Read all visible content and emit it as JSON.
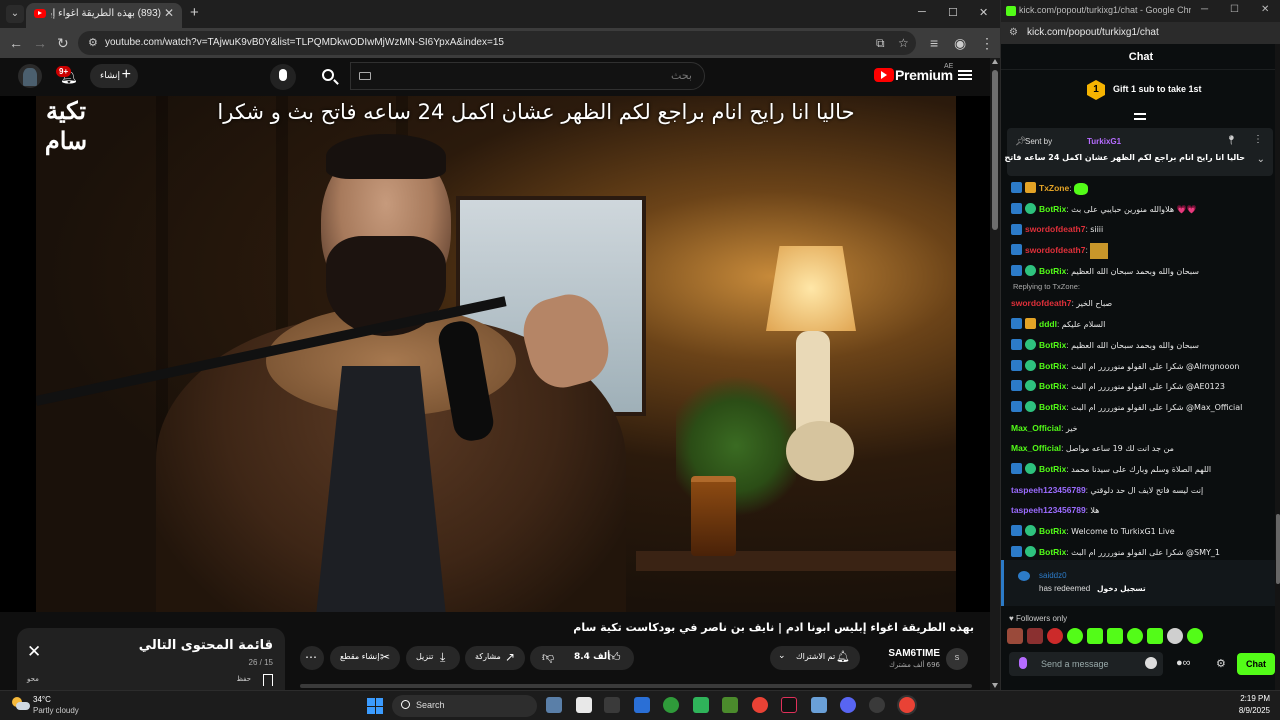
{
  "youtube_window": {
    "tab_title": "(893) بهذه الطريقة اغواء إبليس",
    "url": "youtube.com/watch?v=TAjwuK9vB0Y&list=TLPQMDkwODIwMjWzMN-SI6YpxA&index=15",
    "masthead": {
      "notif_count": "9+",
      "create_label": "إنشاء",
      "search_placeholder": "بحث",
      "logo_text": "Premium",
      "country_code": "AE"
    },
    "video": {
      "channel_logo_line1": "تكية",
      "channel_logo_line2": "سام",
      "on_screen_caption": "حاليا انا رايح انام براجع لكم الظهر عشان اكمل 24 ساعه فاتح بث و شكرا"
    },
    "below": {
      "title": "بهذه الطريقة اغواء إبليس ابونا ادم | نايف بن ناصر في بودكاست تكية سام",
      "channel_name": "SAM6TIME",
      "subscribers": "696 ألف مشترك",
      "subscribed_label": "تم الاشتراك",
      "likes": "8.4 ألف",
      "share_label": "مشاركة",
      "download_label": "تنزيل",
      "clip_label": "إنشاء مقطع"
    },
    "playlist": {
      "title": "قائمة المحتوى التالي",
      "count": "26 / 15",
      "save_label": "حفظ",
      "delete_label": "محو"
    }
  },
  "kick_window": {
    "window_title": "kick.com/popout/turkixg1/chat - Google Chro...",
    "url": "kick.com/popout/turkixg1/chat",
    "header": "Chat",
    "gift_badge": "1",
    "gift_text": "Gift 1 sub to take 1st",
    "pinned": {
      "sent_by_label": "Sent by",
      "sender": "TurkixG1",
      "message": "حاليا انا رايح انام براجع لكم الظهر عشان اكمل 24 ساعه فاتح بث و شكرا"
    },
    "messages": [
      {
        "user": "TxZone",
        "color": "#e3a326",
        "text": "",
        "badges": [
          "mod",
          "sub"
        ],
        "emote": true
      },
      {
        "user": "BotRix",
        "color": "#53fc18",
        "text": "هلاوالله منورين حبايبي على بث 💗💗",
        "badges": [
          "mod",
          "ver"
        ]
      },
      {
        "user": "swordofdeath7",
        "color": "#e0303a",
        "text": "siiii",
        "badges": [
          "mod"
        ]
      },
      {
        "user": "swordofdeath7",
        "color": "#e0303a",
        "text": "",
        "badges": [
          "mod"
        ],
        "emote2": true
      },
      {
        "user": "BotRix",
        "color": "#53fc18",
        "text": "سبحان والله وبحمد سبحان الله العظيم",
        "badges": [
          "mod",
          "ver"
        ]
      },
      {
        "reply_to": "Replying to TxZone:",
        "user": "swordofdeath7",
        "color": "#e0303a",
        "text": "صباح الخير",
        "badges": []
      },
      {
        "user": "dddl",
        "color": "#53fc18",
        "text": "السلام عليكم",
        "badges": [
          "mod",
          "sub"
        ]
      },
      {
        "user": "BotRix",
        "color": "#53fc18",
        "text": "سبحان والله وبحمد سبحان الله العظيم",
        "badges": [
          "mod",
          "ver"
        ]
      },
      {
        "user": "BotRix",
        "color": "#53fc18",
        "text": "شكرا على الفولو منورررر ام البث @Almgnooon",
        "badges": [
          "mod",
          "ver"
        ]
      },
      {
        "user": "BotRix",
        "color": "#53fc18",
        "text": "شكرا على الفولو منورررر ام البث @AE0123",
        "badges": [
          "mod",
          "ver"
        ]
      },
      {
        "user": "BotRix",
        "color": "#53fc18",
        "text": "شكرا على الفولو منورررر ام البث @Max_Official",
        "badges": [
          "mod",
          "ver"
        ]
      },
      {
        "user": "Max_Official",
        "color": "#53fc18",
        "text": "خير",
        "badges": []
      },
      {
        "user": "Max_Official",
        "color": "#53fc18",
        "text": "من جد انت لك 19 ساعه مواصل",
        "badges": []
      },
      {
        "user": "BotRix",
        "color": "#53fc18",
        "text": "اللهم الصلاة وسلم وبارك على سيدنا محمد",
        "badges": [
          "mod",
          "ver"
        ]
      },
      {
        "user": "taspeeh123456789",
        "color": "#9b6cff",
        "text": "إنت ليسه فاتح لايف ال حد دلوقتي",
        "badges": []
      },
      {
        "user": "taspeeh123456789",
        "color": "#9b6cff",
        "text": "هلا",
        "badges": []
      },
      {
        "user": "BotRix",
        "color": "#53fc18",
        "text": "Welcome to TurkixG1 Live",
        "badges": [
          "mod",
          "ver"
        ]
      },
      {
        "user": "BotRix",
        "color": "#53fc18",
        "text": "شكرا على الفولو منورررر ام البث @SMY_1",
        "badges": [
          "mod",
          "ver"
        ]
      }
    ],
    "redeem": {
      "user": "saiddz0",
      "text": "has redeemed",
      "reward": "تسجيل دخول"
    },
    "followers_only": "Followers only",
    "input_placeholder": "Send a message",
    "chat_button": "Chat"
  },
  "taskbar": {
    "temperature": "34°C",
    "weather": "Partly cloudy",
    "search_label": "Search",
    "time": "2:19 PM",
    "date": "8/9/2025"
  }
}
